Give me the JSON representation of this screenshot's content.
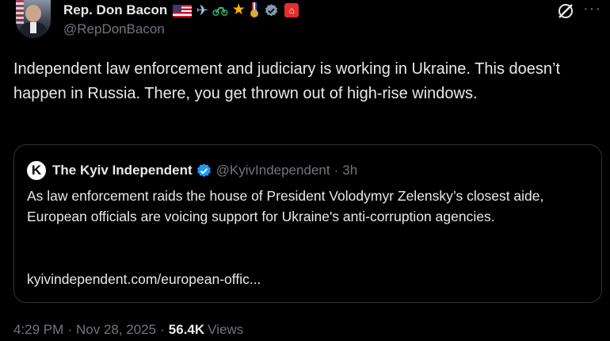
{
  "author": {
    "display_name": "Rep. Don Bacon",
    "handle": "@RepDonBacon",
    "name_emojis": [
      "us-flag",
      "airplane",
      "motorcycle",
      "star",
      "military-medal",
      "grey-verified-badge",
      "red-box"
    ]
  },
  "tweet": {
    "text": "Independent law enforcement and judiciary is working in Ukraine. This doesn’t happen in Russia. There, you get thrown out of high-rise windows."
  },
  "quoted": {
    "logo_letter": "K",
    "display_name": "The Kyiv Independent",
    "handle": "@KyivIndependent",
    "separator": "·",
    "time": "3h",
    "text": "As law enforcement raids the house of President Volodymyr Zelensky’s closest aide, European officials are voicing support for Ukraine's anti-corruption agencies.",
    "link": "kyivindependent.com/european-offic..."
  },
  "meta": {
    "time": "4:29 PM",
    "sep1": "·",
    "date": "Nov 28, 2025",
    "sep2": "·",
    "views_count": "56.4K",
    "views_label": "Views"
  },
  "menu": {
    "more_label": "···"
  },
  "colors": {
    "background": "#000000",
    "text": "#e7e9ea",
    "muted": "#71767b",
    "border": "#2f3336",
    "verified_blue": "#1d9bf0",
    "verified_grey": "#829aab"
  }
}
